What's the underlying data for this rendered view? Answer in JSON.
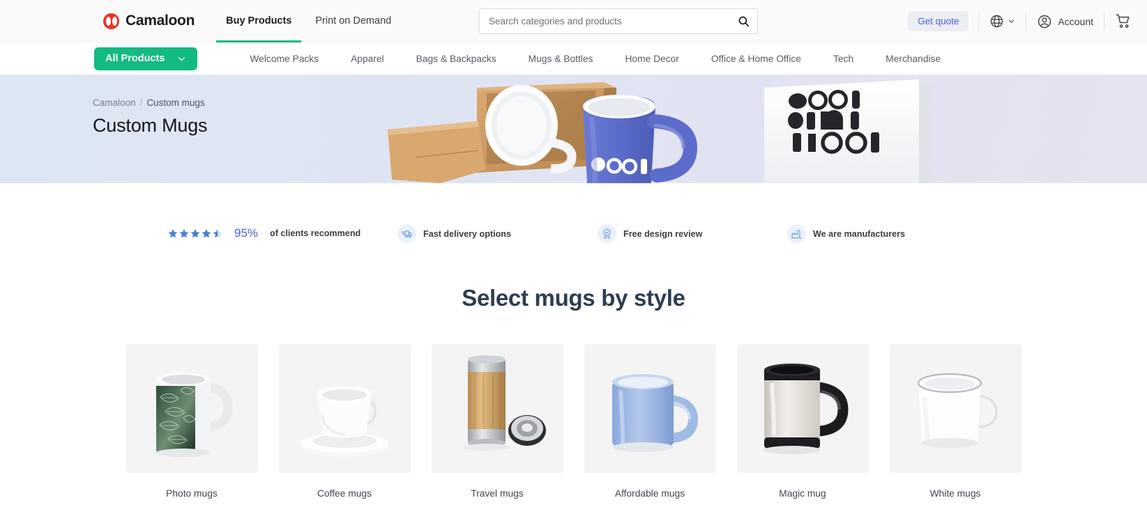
{
  "header": {
    "brand": {
      "name": "Camaloon",
      "logo_icon": "camaloon-logo-icon",
      "color": "#ee3124"
    },
    "nav": [
      {
        "label": "Buy Products",
        "active": true
      },
      {
        "label": "Print on Demand",
        "active": false
      }
    ],
    "search": {
      "placeholder": "Search categories and products",
      "value": "",
      "icon": "search-icon"
    },
    "get_quote_label": "Get quote",
    "get_quote_color": "#4a63d8",
    "language_icon": "globe-icon",
    "language_chevron_icon": "chevron-down-icon",
    "account_label": "Account",
    "account_icon": "user-circle-icon",
    "cart_icon": "shopping-cart-icon"
  },
  "category_nav": {
    "all_products_label": "All Products",
    "all_products_chevron": "chevron-down-icon",
    "accent_color": "#12bb7f",
    "items": [
      {
        "label": "Welcome Packs"
      },
      {
        "label": "Apparel"
      },
      {
        "label": "Bags & Backpacks"
      },
      {
        "label": "Mugs & Bottles"
      },
      {
        "label": "Home Decor"
      },
      {
        "label": "Office & Home Office"
      },
      {
        "label": "Tech"
      },
      {
        "label": "Merchandise"
      }
    ]
  },
  "hero": {
    "breadcrumb": {
      "root": "Camaloon",
      "separator": "/",
      "current": "Custom mugs"
    },
    "title": "Custom Mugs",
    "box_text": "COOLMOON",
    "mug_text": "COOL",
    "bg_from": "#dde6f4",
    "bg_to": "#e6e2f0"
  },
  "trust": {
    "rating": {
      "stars_filled": 4,
      "stars_half": 1,
      "stars_total": 5,
      "percent": "95%",
      "percent_color": "#4a63d8",
      "label": "of clients recommend"
    },
    "badges": [
      {
        "icon": "delivery-truck-icon",
        "label": "Fast delivery options"
      },
      {
        "icon": "award-ribbon-icon",
        "label": "Free design review"
      },
      {
        "icon": "factory-icon",
        "label": "We are manufacturers"
      }
    ]
  },
  "section": {
    "title": "Select mugs by style",
    "title_color": "#2d3e50"
  },
  "products": [
    {
      "label": "Photo mugs",
      "image": "photo-mug-with-leaf-print"
    },
    {
      "label": "Coffee mugs",
      "image": "white-coffee-cup-with-saucer"
    },
    {
      "label": "Travel mugs",
      "image": "bamboo-travel-tumbler"
    },
    {
      "label": "Affordable mugs",
      "image": "light-blue-ceramic-mug"
    },
    {
      "label": "Magic mug",
      "image": "black-and-white-magic-mug"
    },
    {
      "label": "White mugs",
      "image": "white-enamel-mug"
    }
  ]
}
